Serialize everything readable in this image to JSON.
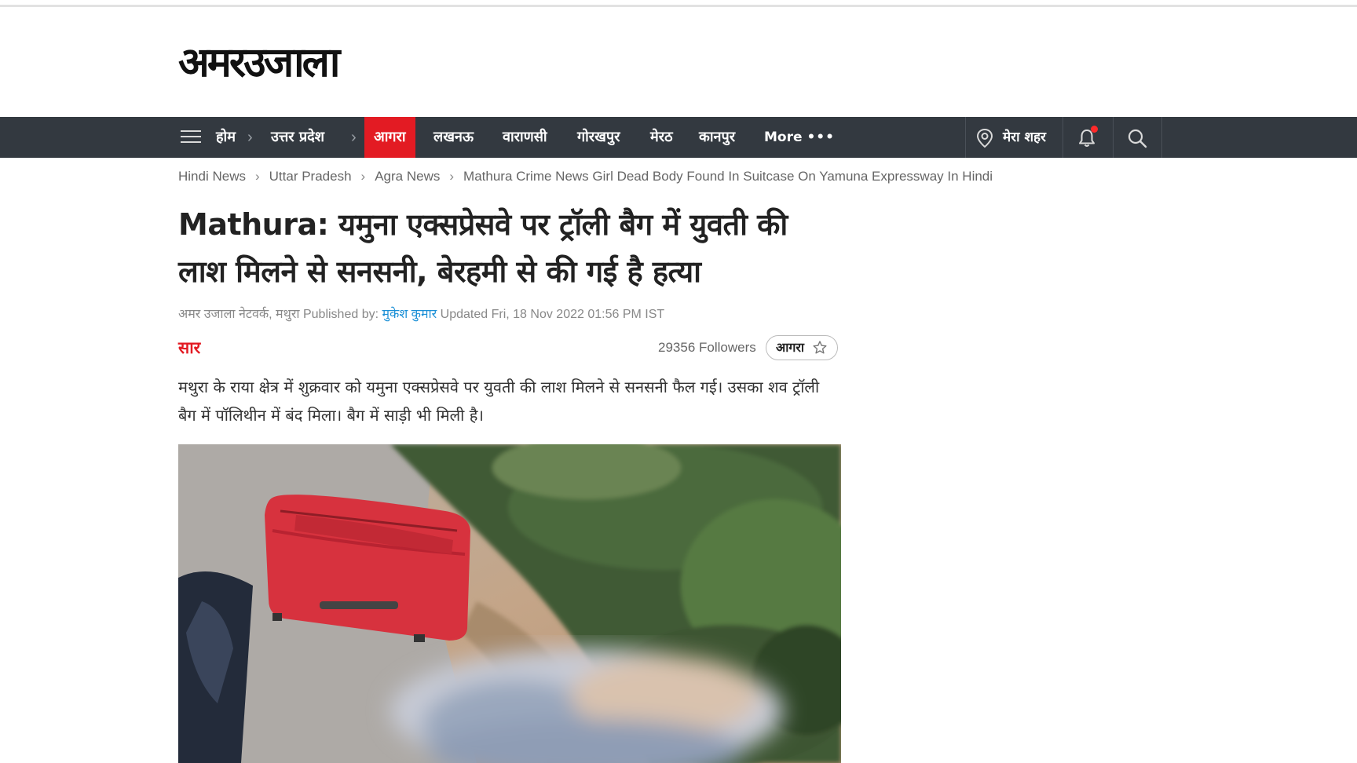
{
  "logo": {
    "text": "अमरउजाला"
  },
  "nav": {
    "items": [
      "होम",
      "उत्तर प्रदेश",
      "आगरा",
      "लखनऊ",
      "वाराणसी",
      "गोरखपुर",
      "मेरठ",
      "कानपुर"
    ],
    "active": "आगरा",
    "more_label": "More",
    "more_dots": "•••",
    "city_label": "मेरा शहर"
  },
  "breadcrumb": [
    "Hindi News",
    "Uttar Pradesh",
    "Agra News",
    "Mathura Crime News Girl Dead Body Found In Suitcase On Yamuna Expressway In Hindi"
  ],
  "breadcrumb_sep": "›",
  "article": {
    "headline": "Mathura: यमुना एक्सप्रेसवे पर ट्रॉली बैग में युवती की लाश मिलने से सनसनी, बेरहमी से की गई है हत्या",
    "source": "अमर उजाला नेटवर्क, मथुरा",
    "published_by_label": "Published by:",
    "author": "मुकेश कुमार",
    "updated": "Updated Fri, 18 Nov 2022 01:56 PM IST",
    "summary_label": "सार",
    "followers": "29356 Followers",
    "follow_city": "आगरा",
    "summary": "मथुरा के राया क्षेत्र में शुक्रवार को यमुना एक्सप्रेसवे पर युवती की लाश मिलने से सनसनी फैल गई। उसका शव ट्रॉली बैग में पॉलिथीन में बंद मिला। बैग में साड़ी भी मिली है।"
  },
  "icons": [
    "menu-icon",
    "location-icon",
    "bell-icon",
    "search-icon",
    "star-icon"
  ],
  "colors": {
    "nav_bg": "#333940",
    "accent": "#e31b23",
    "link": "#1a8fd6"
  }
}
